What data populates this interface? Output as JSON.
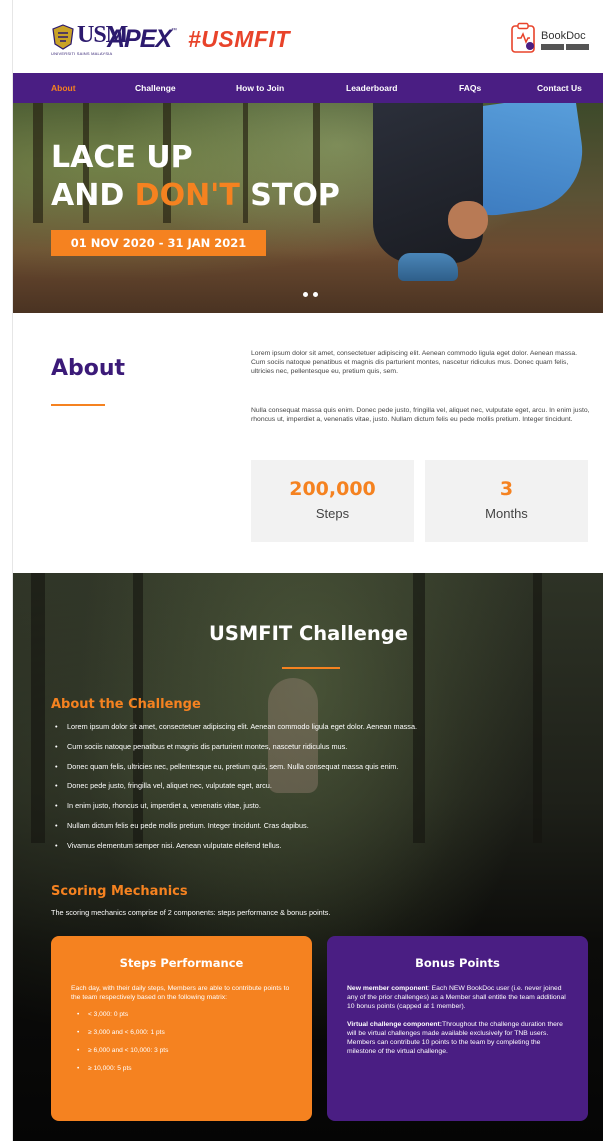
{
  "header": {
    "usm_logo_text": "USM",
    "usm_sub": "UNIVERSITI SAINS MALAYSIA",
    "apex_logo_text": "APEX",
    "apex_tm": "™",
    "usmfit_logo_text": "#USMFIT",
    "bookdoc_text": "BookDoc"
  },
  "nav": {
    "items": [
      "About",
      "Challenge",
      "How to Join",
      "Leaderboard",
      "FAQs",
      "Contact Us"
    ],
    "active": "About",
    "active_color": "#f58220",
    "bar_color": "#4a1e83"
  },
  "hero": {
    "line1": "LACE UP",
    "line2_prefix": "AND ",
    "line2_highlight": "DON'T",
    "line2_suffix": " STOP",
    "date_badge": "01 NOV 2020 - 31 JAN 2021",
    "slides": 2
  },
  "about": {
    "title": "About",
    "paragraph1": "Lorem ipsum dolor sit amet, consectetuer adipiscing elit. Aenean commodo ligula eget dolor. Aenean massa. Cum sociis natoque penatibus et magnis dis parturient montes, nascetur ridiculus mus. Donec quam felis, ultricies nec, pellentesque eu, pretium quis, sem.",
    "paragraph2": "Nulla consequat massa quis enim. Donec pede justo, fringilla vel, aliquet nec, vulputate eget, arcu. In enim justo, rhoncus ut, imperdiet a, venenatis vitae, justo. Nullam dictum felis eu pede mollis pretium. Integer tincidunt.",
    "stats": [
      {
        "value": "200,000",
        "label": "Steps"
      },
      {
        "value": "3",
        "label": "Months"
      }
    ]
  },
  "challenge": {
    "title": "USMFIT Challenge",
    "about_heading": "About the Challenge",
    "bullets": [
      "Lorem ipsum dolor sit amet, consectetuer adipiscing elit. Aenean commodo ligula eget dolor. Aenean massa.",
      "Cum sociis natoque penatibus et magnis dis parturient montes, nascetur ridiculus mus.",
      "Donec quam felis, ultricies nec, pellentesque eu, pretium quis, sem. Nulla consequat massa quis enim.",
      "Donec pede justo, fringilla vel, aliquet nec, vulputate eget, arcu.",
      "In enim justo, rhoncus ut, imperdiet a, venenatis vitae, justo.",
      "Nullam dictum felis eu pede mollis pretium. Integer tincidunt. Cras dapibus.",
      "Vivamus elementum semper nisi. Aenean vulputate eleifend tellus."
    ],
    "scoring_heading": "Scoring Mechanics",
    "scoring_intro": "The scoring mechanics comprise of 2 components: steps performance & bonus points.",
    "steps_card": {
      "title": "Steps Performance",
      "text": "Each day, with their daily steps, Members are able to contribute points to the team respectively based on the following matrix:",
      "tiers": [
        "< 3,000: 0 pts",
        "≥ 3,000 and < 6,000: 1 pts",
        "≥ 6,000 and < 10,000: 3 pts",
        "≥ 10,000: 5 pts"
      ]
    },
    "bonus_card": {
      "title": "Bonus Points",
      "item1_bold": "New member component",
      "item1_text": ": Each NEW BookDoc user (i.e. never joined any of the prior challenges) as a Member shall entitle the team additional 10 bonus points (capped at 1 member).",
      "item2_bold": "Virtual challenge component:",
      "item2_text": "Throughout the challenge duration there will be virtual challenges made available exclusively for TNB users. Members can contribute 10 points to the team by completing the milestone of the virtual challenge."
    }
  },
  "colors": {
    "accent": "#f58220",
    "brand_purple": "#4a1e83",
    "title_purple": "#3b1a78"
  }
}
